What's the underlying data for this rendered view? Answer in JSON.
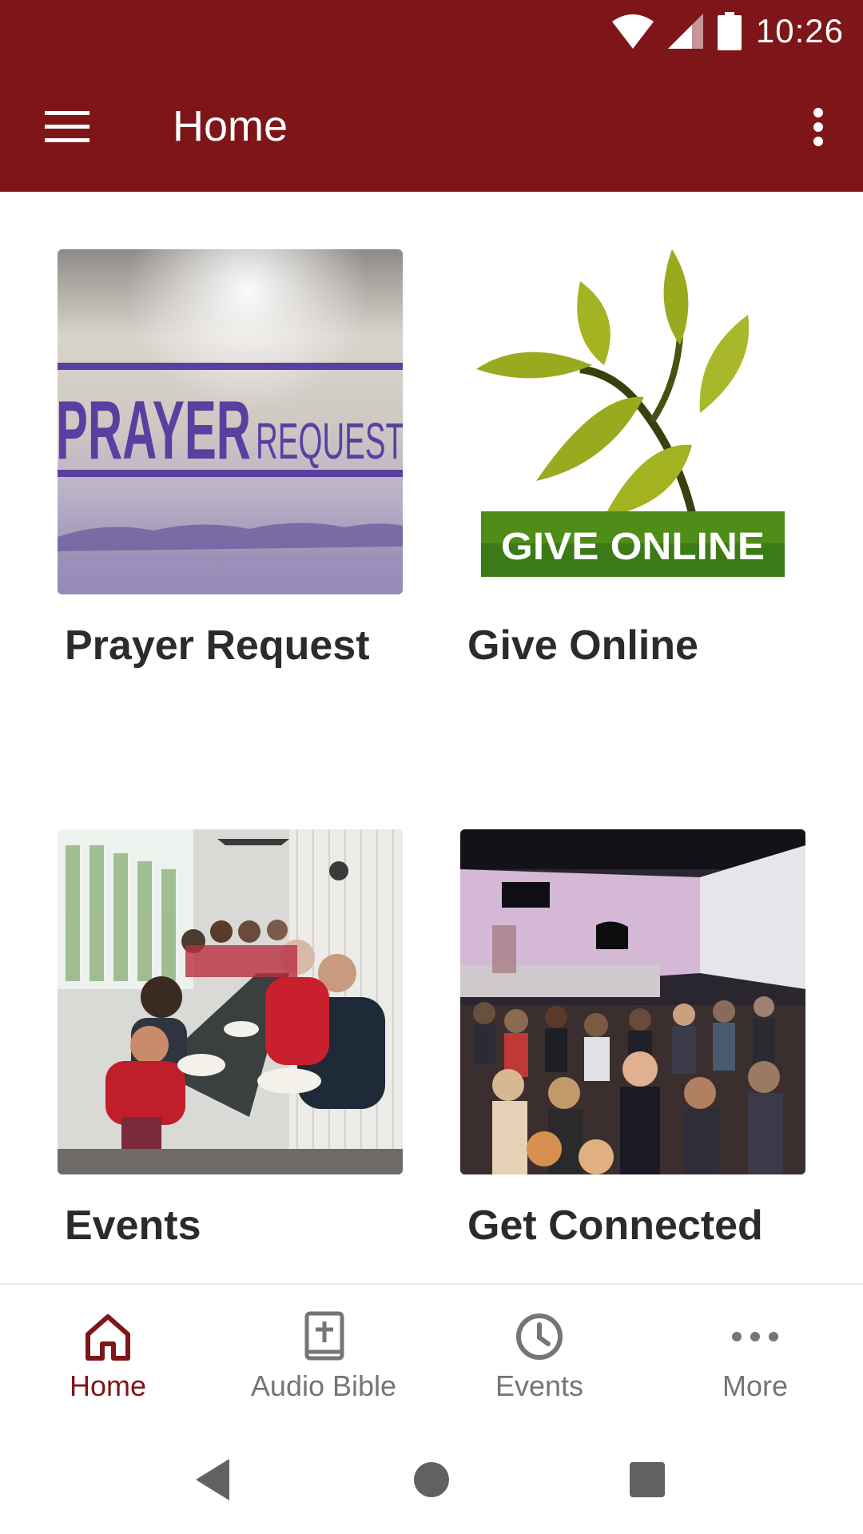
{
  "status_bar": {
    "time": "10:26",
    "icons": [
      "wifi-icon",
      "cell-signal-icon",
      "battery-icon"
    ]
  },
  "app_bar": {
    "title": "Home",
    "menu_icon": "hamburger-menu-icon",
    "overflow_icon": "more-vert-icon"
  },
  "tiles": [
    {
      "label": "Prayer Request",
      "image": "prayer-request-banner",
      "image_text": {
        "word1": "PRAYER",
        "word2": "REQUEST"
      }
    },
    {
      "label": "Give Online",
      "image": "give-online-plant-logo",
      "image_text": {
        "banner": "GIVE ONLINE"
      }
    },
    {
      "label": "Events",
      "image": "events-group-dinner-photo"
    },
    {
      "label": "Get Connected",
      "image": "church-sanctuary-photo"
    }
  ],
  "bottom_nav": {
    "items": [
      {
        "label": "Home",
        "icon": "home-icon",
        "active": true
      },
      {
        "label": "Audio Bible",
        "icon": "bible-icon",
        "active": false
      },
      {
        "label": "Events",
        "icon": "clock-icon",
        "active": false
      },
      {
        "label": "More",
        "icon": "more-horiz-icon",
        "active": false
      }
    ]
  },
  "colors": {
    "primary": "#7e1619",
    "tile_label": "#2b2b2b",
    "nav_inactive": "#757575",
    "give_green": "#9aaa1e"
  }
}
